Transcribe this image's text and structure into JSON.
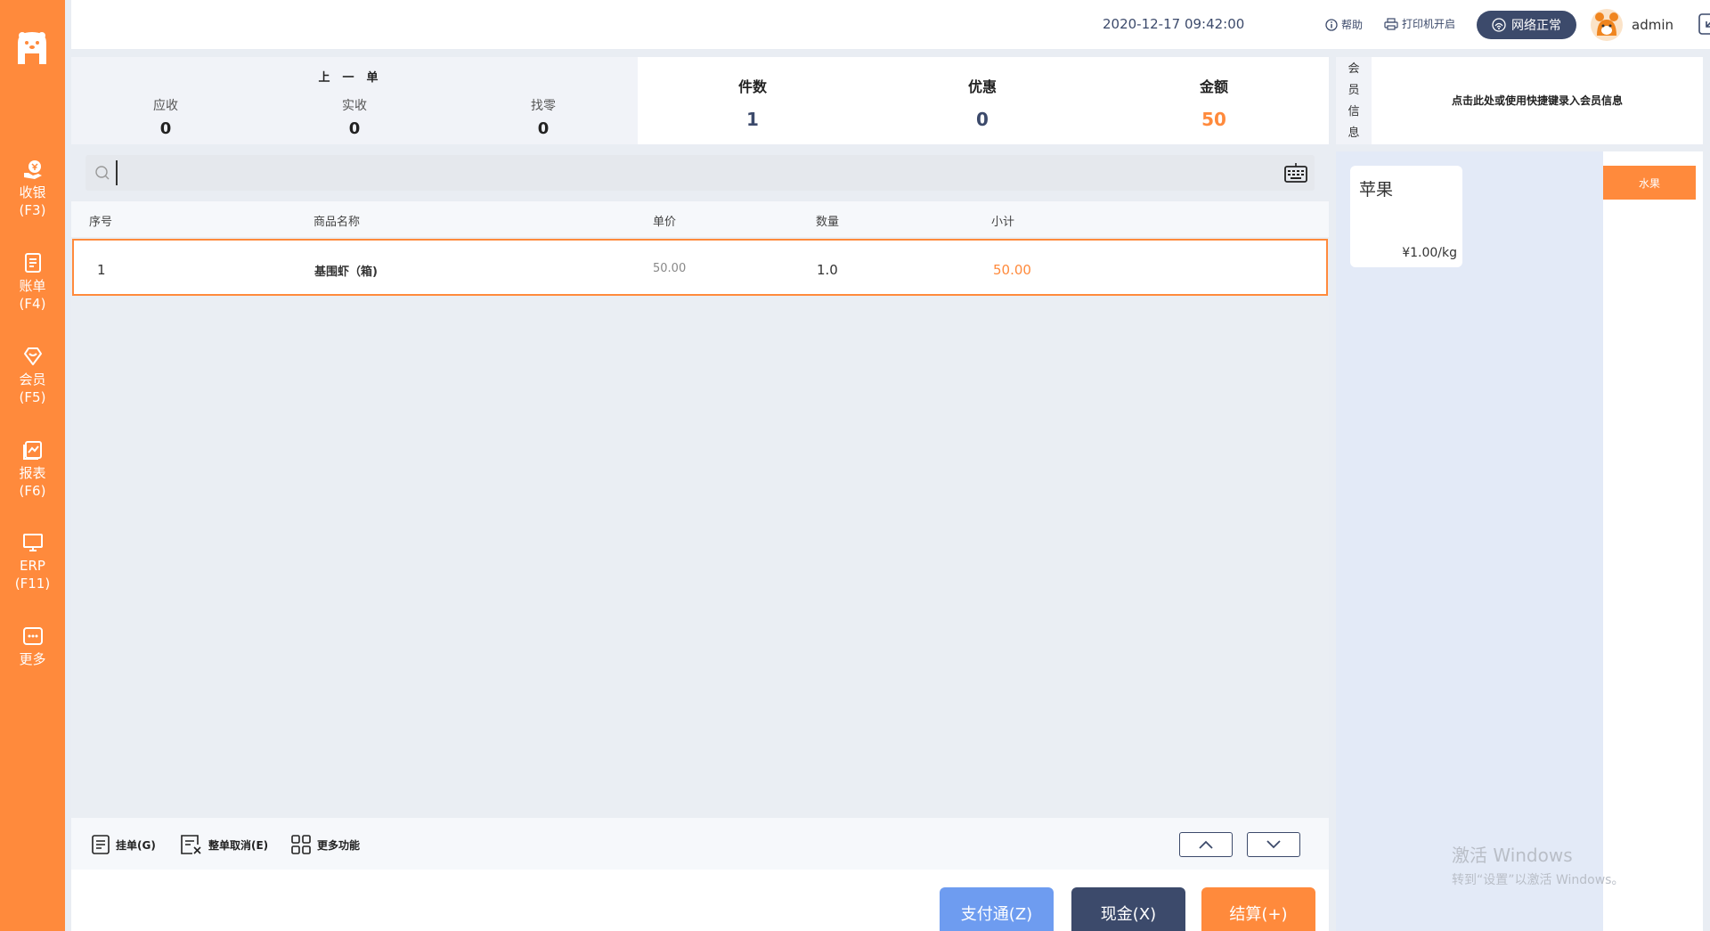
{
  "sidebar": {
    "items": [
      {
        "label": "收银",
        "key": "(F3)",
        "icon": "cashier-icon"
      },
      {
        "label": "账单",
        "key": "(F4)",
        "icon": "bill-icon"
      },
      {
        "label": "会员",
        "key": "(F5)",
        "icon": "member-icon"
      },
      {
        "label": "报表",
        "key": "(F6)",
        "icon": "report-icon"
      },
      {
        "label": "ERP",
        "key": "(F11)",
        "icon": "monitor-icon"
      },
      {
        "label": "更多",
        "key": "",
        "icon": "more-icon"
      }
    ]
  },
  "topbar": {
    "datetime": "2020-12-17 09:42:00",
    "help": "帮助",
    "printer": "打印机开启",
    "network": "网络正常",
    "user": "admin"
  },
  "previous_order": {
    "title": "上一单",
    "receivable_label": "应收",
    "receivable": "0",
    "received_label": "实收",
    "received": "0",
    "change_label": "找零",
    "change": "0"
  },
  "totals": {
    "count_label": "件数",
    "count": "1",
    "discount_label": "优惠",
    "discount": "0",
    "amount_label": "金额",
    "amount": "50"
  },
  "search": {
    "value": ""
  },
  "table": {
    "headers": [
      "序号",
      "商品名称",
      "单价",
      "数量",
      "小计"
    ],
    "rows": [
      {
        "no": "1",
        "name": "基围虾（箱)",
        "price": "50.00",
        "qty": "1.0",
        "subtotal": "50.00"
      }
    ]
  },
  "toolbar": {
    "hold": "挂单(G)",
    "cancel": "整单取消(E)",
    "more": "更多功能"
  },
  "pay": {
    "zft": "支付通(Z)",
    "cash": "现金(X)",
    "settle": "结算(+)"
  },
  "member": {
    "title": [
      "会",
      "员",
      "信",
      "息"
    ],
    "hint": "点击此处或使用快捷键录入会员信息"
  },
  "goods": [
    {
      "name": "苹果",
      "price": "¥1.00/kg"
    }
  ],
  "categories": [
    "水果"
  ],
  "watermark": {
    "line1": "激活 Windows",
    "line2": "转到“设置”以激活 Windows。"
  },
  "colors": {
    "accent": "#ff8a3c",
    "navy": "#3c4a6b",
    "blue": "#6e9cf0"
  }
}
